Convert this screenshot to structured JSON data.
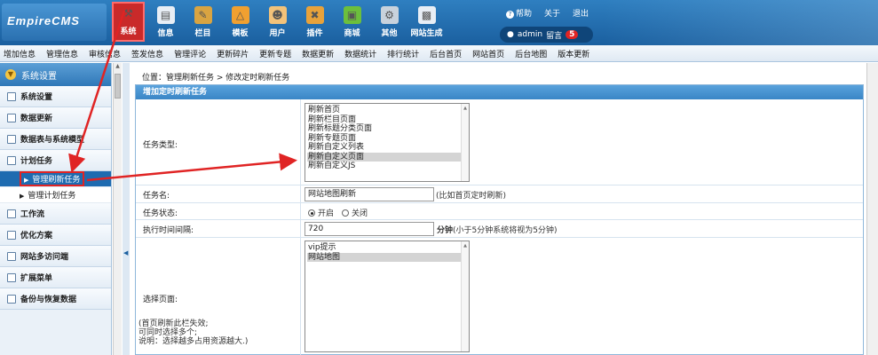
{
  "header": {
    "logo": "EmpireCMS",
    "nav": [
      {
        "label": "系统",
        "icon": "tools-icon",
        "color": "#c92a2a",
        "active": true
      },
      {
        "label": "信息",
        "icon": "document-icon",
        "color": "#e8eef5"
      },
      {
        "label": "栏目",
        "icon": "pencil-icon",
        "color": "#d9a441"
      },
      {
        "label": "模板",
        "icon": "network-icon",
        "color": "#f0a030"
      },
      {
        "label": "用户",
        "icon": "user-icon",
        "color": "#f2c27a"
      },
      {
        "label": "插件",
        "icon": "wrench-icon",
        "color": "#e8a23a"
      },
      {
        "label": "商城",
        "icon": "cart-icon",
        "color": "#6cbf3c"
      },
      {
        "label": "其他",
        "icon": "gear-icon",
        "color": "#c8d2dc"
      },
      {
        "label": "网站生成",
        "icon": "generate-icon",
        "color": "#e8eef5"
      }
    ],
    "links": {
      "help": "帮助",
      "about": "关于",
      "logout": "退出"
    },
    "user": {
      "name": "admin",
      "message_label": "留言",
      "message_count": "5"
    }
  },
  "subnav": [
    "增加信息",
    "管理信息",
    "审核信息",
    "签发信息",
    "管理评论",
    "更新碎片",
    "更新专题",
    "数据更新",
    "数据统计",
    "排行统计",
    "后台首页",
    "网站首页",
    "后台地图",
    "版本更新"
  ],
  "sidebar": {
    "title": "系统设置",
    "items": [
      {
        "label": "系统设置"
      },
      {
        "label": "数据更新"
      },
      {
        "label": "数据表与系统模型"
      },
      {
        "label": "计划任务"
      }
    ],
    "subitems": [
      {
        "label": "管理刷新任务",
        "active": true
      },
      {
        "label": "管理计划任务",
        "active": false
      }
    ],
    "items2": [
      {
        "label": "工作流"
      },
      {
        "label": "优化方案"
      },
      {
        "label": "网站多访问端"
      },
      {
        "label": "扩展菜单"
      },
      {
        "label": "备份与恢复数据"
      }
    ]
  },
  "main": {
    "breadcrumb": "位置：管理刷新任务 > 修改定时刷新任务",
    "panel_title": "增加定时刷新任务",
    "task_type": {
      "label": "任务类型:",
      "options": [
        "刷新首页",
        "刷新栏目页面",
        "刷新标题分类页面",
        "刷新专题页面",
        "刷新自定义列表",
        "刷新自定义页面",
        "刷新自定义JS"
      ],
      "selected": [
        5
      ]
    },
    "task_name": {
      "label": "任务名:",
      "value": "网站地图刷新",
      "hint": "(比如首页定时刷新)"
    },
    "task_status": {
      "label": "任务状态:",
      "on": "开启",
      "off": "关闭"
    },
    "interval": {
      "label": "执行时间间隔:",
      "value": "720",
      "hint_unit": "分钟",
      "hint": "(小于5分钟系统将视为5分钟)"
    },
    "select_page": {
      "label": "选择页面:",
      "options": [
        "vip提示",
        "网站地图"
      ],
      "selected": [
        1
      ],
      "note1": "(首页刷新此栏失效;",
      "note2": "可同时选择多个;",
      "note3": "说明：选择越多占用资源越大.)"
    }
  }
}
